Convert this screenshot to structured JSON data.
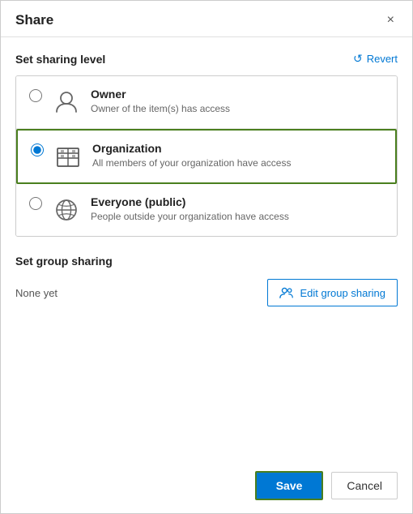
{
  "dialog": {
    "title": "Share",
    "close_label": "×"
  },
  "sharing_level": {
    "section_title": "Set sharing level",
    "revert_label": "Revert",
    "options": [
      {
        "id": "owner",
        "label": "Owner",
        "desc": "Owner of the item(s) has access",
        "selected": false,
        "icon": "person-icon"
      },
      {
        "id": "organization",
        "label": "Organization",
        "desc": "All members of your organization have access",
        "selected": true,
        "icon": "org-icon"
      },
      {
        "id": "everyone",
        "label": "Everyone (public)",
        "desc": "People outside your organization have access",
        "selected": false,
        "icon": "globe-icon"
      }
    ]
  },
  "group_sharing": {
    "section_title": "Set group sharing",
    "none_yet_label": "None yet",
    "edit_button_label": "Edit group sharing"
  },
  "footer": {
    "save_label": "Save",
    "cancel_label": "Cancel"
  }
}
